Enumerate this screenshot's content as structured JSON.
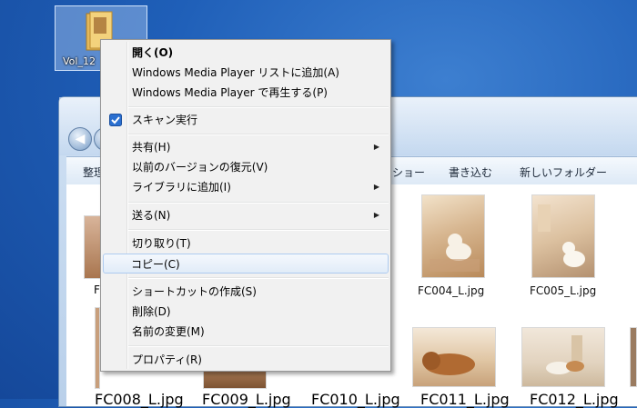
{
  "desktop": {
    "icon_label": "Vol_12"
  },
  "window": {
    "toolbar": [
      "整理",
      "ショー",
      "書き込む",
      "新しいフォルダー"
    ]
  },
  "thumbnails": [
    {
      "caption": "FC004_L.jpg"
    },
    {
      "caption": "FC005_L.jpg"
    },
    {
      "caption": "FC008_L.jpg"
    },
    {
      "caption": "FC009_L.jpg"
    },
    {
      "caption": "FC010_L.jpg"
    },
    {
      "caption": "FC011_L.jpg"
    },
    {
      "caption": "FC012_L.jpg"
    }
  ],
  "partial_caption": "F",
  "context_menu": {
    "open": "開く(O)",
    "add_to_wmp": "Windows Media Player リストに追加(A)",
    "play_wmp": "Windows Media Player で再生する(P)",
    "scan": "スキャン実行",
    "share": "共有(H)",
    "restore": "以前のバージョンの復元(V)",
    "add_library": "ライブラリに追加(I)",
    "send_to": "送る(N)",
    "cut": "切り取り(T)",
    "copy": "コピー(C)",
    "shortcut": "ショートカットの作成(S)",
    "delete": "削除(D)",
    "rename": "名前の変更(M)",
    "properties": "プロパティ(R)"
  },
  "colors": {
    "desktop": "#1f5fb8",
    "menu_bg": "#f1f1f1",
    "highlight_border": "#aecbf0"
  }
}
